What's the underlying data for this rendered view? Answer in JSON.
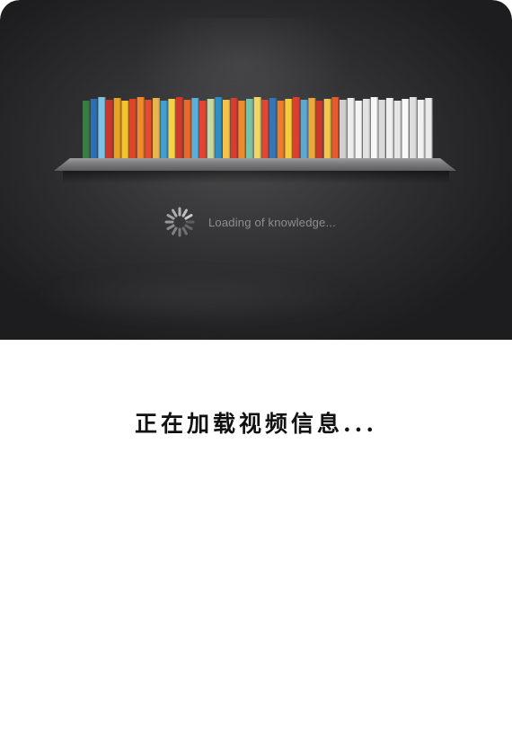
{
  "loading_banner": {
    "caption": "Loading of knowledge...",
    "spinner_icon": "loading-spinner-icon",
    "book_colors": [
      "#3a7d44",
      "#2e6fb0",
      "#7fc3e3",
      "#c9362d",
      "#e8a323",
      "#f2c230",
      "#d9472b",
      "#f08a2a",
      "#e14c32",
      "#e6b64a",
      "#3f9fd1",
      "#f2d34a",
      "#cc3b2e",
      "#e76a2b",
      "#5ab0d8",
      "#e24633",
      "#c8d9a0",
      "#2f8ec4",
      "#f4c247",
      "#d63c30",
      "#e98c30",
      "#79c1a8",
      "#f1d46a",
      "#dc4a36",
      "#3476b8",
      "#ec7d2e",
      "#f6cb3c",
      "#d8412f",
      "#5ca8d2",
      "#e9a93c",
      "#c43a2f",
      "#f2c64a",
      "#e45b31",
      "#d0d0d0",
      "#ececec",
      "#f4f4f4",
      "#e2e2e2",
      "#f7f7f7",
      "#dadada",
      "#efefef",
      "#e6e6e6",
      "#f9f9f9",
      "#dedede",
      "#f1f1f1",
      "#e9e9e9"
    ]
  },
  "status": {
    "message": "正在加载视频信息..."
  }
}
